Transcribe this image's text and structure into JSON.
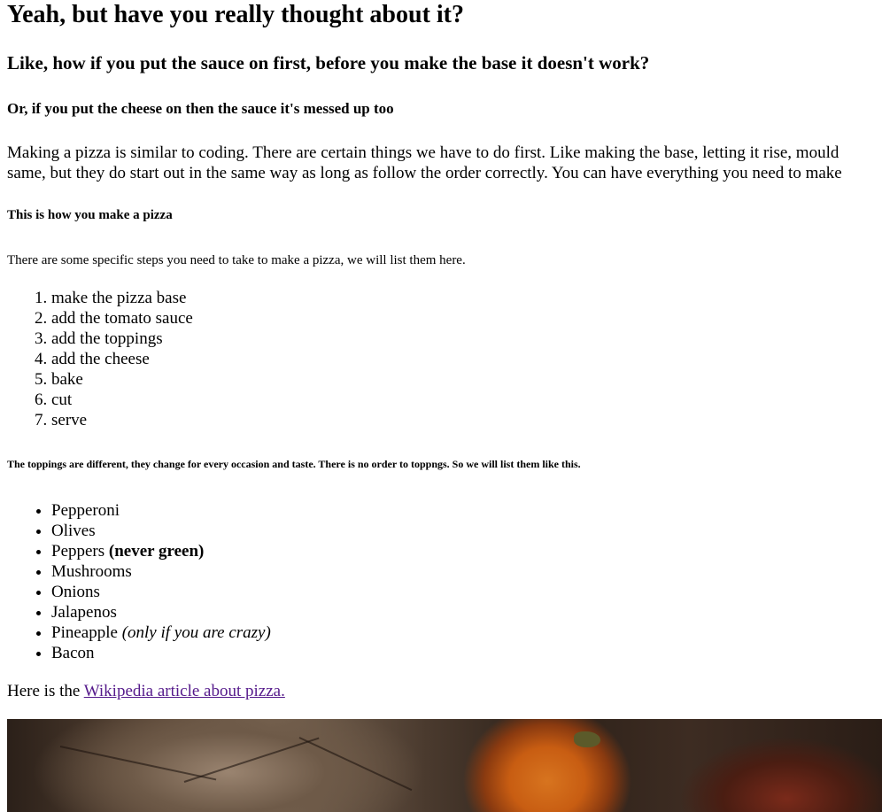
{
  "heading1": "Yeah, but have you really thought about it?",
  "heading2": "Like, how if you put the sauce on first, before you make the base it doesn't work?",
  "heading3": "Or, if you put the cheese on then the sauce it's messed up too",
  "intro": {
    "line1": "Making a pizza is similar to coding. There are certain things we have to do first. Like making the base, letting it rise, mould",
    "line2": "same, but they do start out in the same way as long as follow the order correctly. You can have everything you need to make"
  },
  "heading4": "This is how you make a pizza",
  "steps_intro": "There are some specific steps you need to take to make a pizza, we will list them here.",
  "steps": [
    "make the pizza base",
    "add the tomato sauce",
    "add the toppings",
    "add the cheese",
    "bake",
    "cut",
    "serve"
  ],
  "heading6": "The toppings are different, they change for every occasion and taste. There is no order to toppngs. So we will list them like this.",
  "toppings": [
    {
      "name": "Pepperoni"
    },
    {
      "name": "Olives"
    },
    {
      "name": "Peppers",
      "strong": "(never green)"
    },
    {
      "name": "Mushrooms"
    },
    {
      "name": "Onions"
    },
    {
      "name": "Jalapenos"
    },
    {
      "name": "Pineapple",
      "em": "(only if you are crazy)"
    },
    {
      "name": "Bacon"
    }
  ],
  "wiki": {
    "prefix": "Here is the ",
    "link_text": "Wikipedia article about pizza."
  },
  "colors": {
    "link_visited": "#551a8b",
    "text": "#000000",
    "background": "#ffffff"
  }
}
